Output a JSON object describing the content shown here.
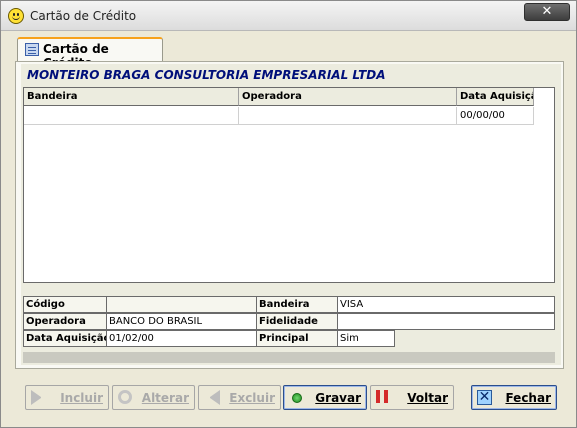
{
  "window": {
    "title": "Cartão de Crédito",
    "close_label": "✕"
  },
  "tab": {
    "label": "Cartão de Crédito"
  },
  "company": "MONTEIRO BRAGA CONSULTORIA EMPRESARIAL LTDA",
  "grid": {
    "columns": [
      "Bandeira",
      "Operadora",
      "Data Aquisição"
    ],
    "rows": [
      [
        "",
        "",
        "00/00/00"
      ]
    ]
  },
  "details": {
    "codigo_label": "Código",
    "codigo_value": "",
    "bandeira_label": "Bandeira",
    "bandeira_value": "VISA",
    "operadora_label": "Operadora",
    "operadora_value": "BANCO DO BRASIL",
    "fidelidade_label": "Fidelidade",
    "fidelidade_value": "",
    "data_label": "Data Aquisição",
    "data_value": "01/02/00",
    "principal_label": "Principal",
    "principal_value": "Sim"
  },
  "buttons": {
    "incluir": "Incluir",
    "alterar": "Alterar",
    "excluir": "Excluir",
    "gravar": "Gravar",
    "voltar": "Voltar",
    "fechar": "Fechar"
  },
  "icons": {
    "title": "smiley-icon",
    "tab": "card-list-icon",
    "incluir": "arrow-right-icon",
    "alterar": "refresh-icon",
    "excluir": "arrow-left-icon",
    "gravar": "green-dot-icon",
    "voltar": "pause-icon",
    "fechar": "close-x-icon"
  },
  "colors": {
    "company_text": "#000f7a",
    "tab_accent": "#f7a21b",
    "active_border": "#2b4e8c"
  }
}
